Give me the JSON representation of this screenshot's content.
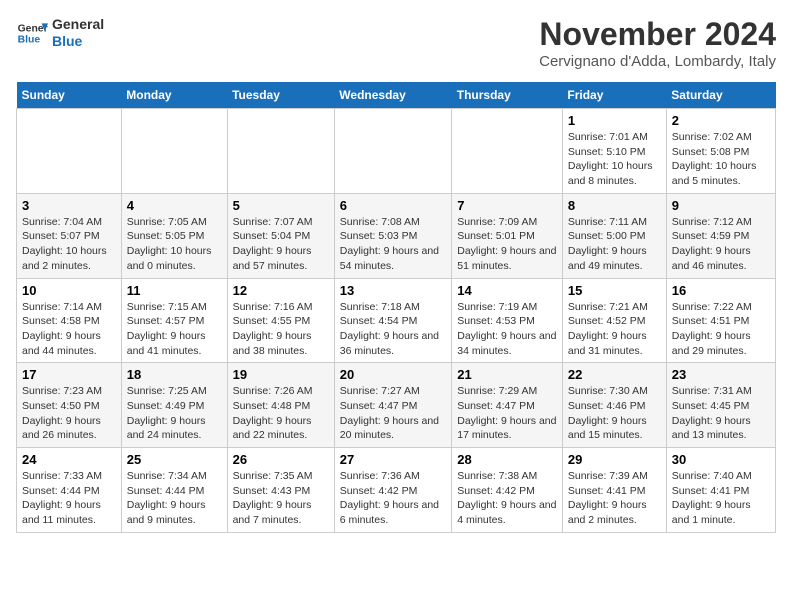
{
  "logo": {
    "line1": "General",
    "line2": "Blue"
  },
  "title": "November 2024",
  "subtitle": "Cervignano d'Adda, Lombardy, Italy",
  "days_of_week": [
    "Sunday",
    "Monday",
    "Tuesday",
    "Wednesday",
    "Thursday",
    "Friday",
    "Saturday"
  ],
  "weeks": [
    [
      {
        "day": "",
        "info": ""
      },
      {
        "day": "",
        "info": ""
      },
      {
        "day": "",
        "info": ""
      },
      {
        "day": "",
        "info": ""
      },
      {
        "day": "",
        "info": ""
      },
      {
        "day": "1",
        "info": "Sunrise: 7:01 AM\nSunset: 5:10 PM\nDaylight: 10 hours and 8 minutes."
      },
      {
        "day": "2",
        "info": "Sunrise: 7:02 AM\nSunset: 5:08 PM\nDaylight: 10 hours and 5 minutes."
      }
    ],
    [
      {
        "day": "3",
        "info": "Sunrise: 7:04 AM\nSunset: 5:07 PM\nDaylight: 10 hours and 2 minutes."
      },
      {
        "day": "4",
        "info": "Sunrise: 7:05 AM\nSunset: 5:05 PM\nDaylight: 10 hours and 0 minutes."
      },
      {
        "day": "5",
        "info": "Sunrise: 7:07 AM\nSunset: 5:04 PM\nDaylight: 9 hours and 57 minutes."
      },
      {
        "day": "6",
        "info": "Sunrise: 7:08 AM\nSunset: 5:03 PM\nDaylight: 9 hours and 54 minutes."
      },
      {
        "day": "7",
        "info": "Sunrise: 7:09 AM\nSunset: 5:01 PM\nDaylight: 9 hours and 51 minutes."
      },
      {
        "day": "8",
        "info": "Sunrise: 7:11 AM\nSunset: 5:00 PM\nDaylight: 9 hours and 49 minutes."
      },
      {
        "day": "9",
        "info": "Sunrise: 7:12 AM\nSunset: 4:59 PM\nDaylight: 9 hours and 46 minutes."
      }
    ],
    [
      {
        "day": "10",
        "info": "Sunrise: 7:14 AM\nSunset: 4:58 PM\nDaylight: 9 hours and 44 minutes."
      },
      {
        "day": "11",
        "info": "Sunrise: 7:15 AM\nSunset: 4:57 PM\nDaylight: 9 hours and 41 minutes."
      },
      {
        "day": "12",
        "info": "Sunrise: 7:16 AM\nSunset: 4:55 PM\nDaylight: 9 hours and 38 minutes."
      },
      {
        "day": "13",
        "info": "Sunrise: 7:18 AM\nSunset: 4:54 PM\nDaylight: 9 hours and 36 minutes."
      },
      {
        "day": "14",
        "info": "Sunrise: 7:19 AM\nSunset: 4:53 PM\nDaylight: 9 hours and 34 minutes."
      },
      {
        "day": "15",
        "info": "Sunrise: 7:21 AM\nSunset: 4:52 PM\nDaylight: 9 hours and 31 minutes."
      },
      {
        "day": "16",
        "info": "Sunrise: 7:22 AM\nSunset: 4:51 PM\nDaylight: 9 hours and 29 minutes."
      }
    ],
    [
      {
        "day": "17",
        "info": "Sunrise: 7:23 AM\nSunset: 4:50 PM\nDaylight: 9 hours and 26 minutes."
      },
      {
        "day": "18",
        "info": "Sunrise: 7:25 AM\nSunset: 4:49 PM\nDaylight: 9 hours and 24 minutes."
      },
      {
        "day": "19",
        "info": "Sunrise: 7:26 AM\nSunset: 4:48 PM\nDaylight: 9 hours and 22 minutes."
      },
      {
        "day": "20",
        "info": "Sunrise: 7:27 AM\nSunset: 4:47 PM\nDaylight: 9 hours and 20 minutes."
      },
      {
        "day": "21",
        "info": "Sunrise: 7:29 AM\nSunset: 4:47 PM\nDaylight: 9 hours and 17 minutes."
      },
      {
        "day": "22",
        "info": "Sunrise: 7:30 AM\nSunset: 4:46 PM\nDaylight: 9 hours and 15 minutes."
      },
      {
        "day": "23",
        "info": "Sunrise: 7:31 AM\nSunset: 4:45 PM\nDaylight: 9 hours and 13 minutes."
      }
    ],
    [
      {
        "day": "24",
        "info": "Sunrise: 7:33 AM\nSunset: 4:44 PM\nDaylight: 9 hours and 11 minutes."
      },
      {
        "day": "25",
        "info": "Sunrise: 7:34 AM\nSunset: 4:44 PM\nDaylight: 9 hours and 9 minutes."
      },
      {
        "day": "26",
        "info": "Sunrise: 7:35 AM\nSunset: 4:43 PM\nDaylight: 9 hours and 7 minutes."
      },
      {
        "day": "27",
        "info": "Sunrise: 7:36 AM\nSunset: 4:42 PM\nDaylight: 9 hours and 6 minutes."
      },
      {
        "day": "28",
        "info": "Sunrise: 7:38 AM\nSunset: 4:42 PM\nDaylight: 9 hours and 4 minutes."
      },
      {
        "day": "29",
        "info": "Sunrise: 7:39 AM\nSunset: 4:41 PM\nDaylight: 9 hours and 2 minutes."
      },
      {
        "day": "30",
        "info": "Sunrise: 7:40 AM\nSunset: 4:41 PM\nDaylight: 9 hours and 1 minute."
      }
    ]
  ]
}
